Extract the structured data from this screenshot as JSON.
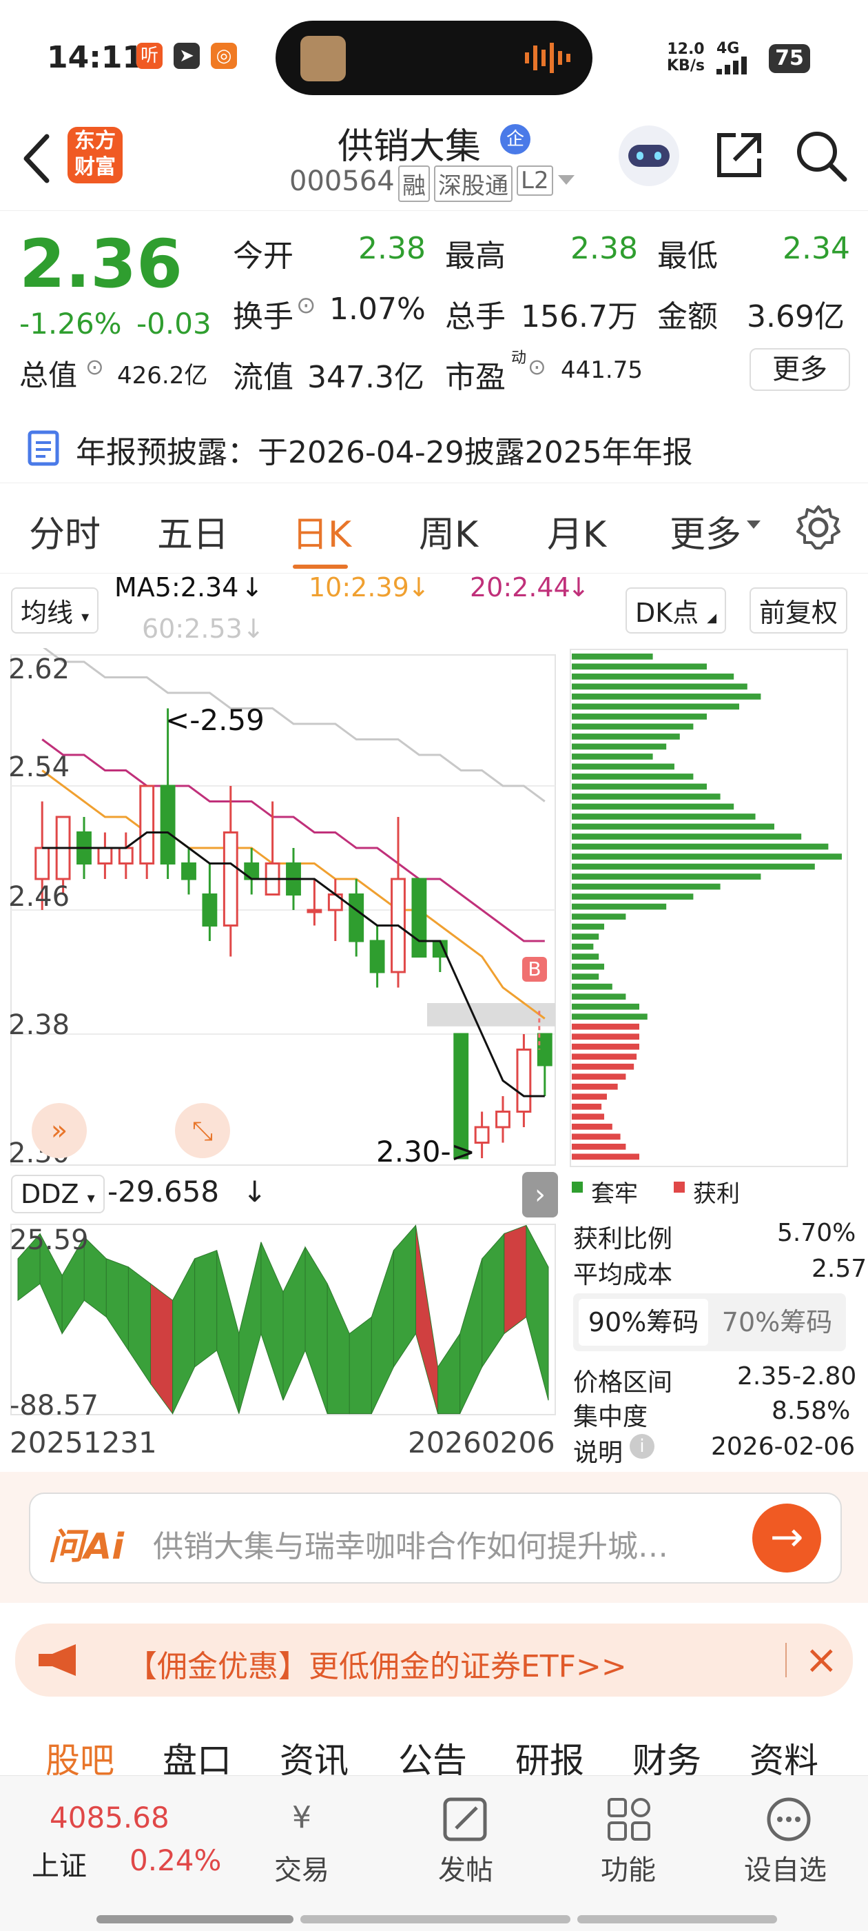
{
  "status": {
    "time": "14:11",
    "net_speed": "12.0",
    "net_unit": "KB/s",
    "net_type": "4G",
    "battery": "75"
  },
  "header": {
    "stock_name": "供销大集",
    "badge": "企",
    "code": "000564",
    "tags": [
      "融",
      "深股通",
      "L2"
    ]
  },
  "quote": {
    "price": "2.36",
    "change_pct": "-1.26%",
    "change": "-0.03",
    "open_label": "今开",
    "open": "2.38",
    "high_label": "最高",
    "high": "2.38",
    "low_label": "最低",
    "low": "2.34",
    "turnover_label": "换手",
    "turnover": "1.07%",
    "volume_label": "总手",
    "volume": "156.7万",
    "amount_label": "金额",
    "amount": "3.69亿",
    "mktcap_label": "总值",
    "mktcap": "426.2亿",
    "float_label": "流值",
    "float": "347.3亿",
    "pe_label": "市盈",
    "pe_sup": "动",
    "pe": "441.75",
    "more": "更多"
  },
  "banner": {
    "text": "年报预披露：于2026-04-29披露2025年年报"
  },
  "tabs": [
    {
      "label": "分时"
    },
    {
      "label": "五日"
    },
    {
      "label": "日K"
    },
    {
      "label": "周K"
    },
    {
      "label": "月K"
    },
    {
      "label": "更多"
    }
  ],
  "ma": {
    "selector": "均线",
    "ma5": "MA5:2.34",
    "ma10": "10:2.39",
    "ma20": "20:2.44",
    "ma60": "60:2.53",
    "dk": "DK点",
    "adjust": "前复权"
  },
  "kline": {
    "y_ticks": [
      "2.62",
      "2.54",
      "2.46",
      "2.38",
      "2.30"
    ],
    "annot_high": "<-2.59",
    "annot_low": "2.30->",
    "b_marker": "B",
    "colors": {
      "up": "#e04848",
      "down": "#2f9e2f",
      "ma5": "#111111",
      "ma10": "#f0a030",
      "ma20": "#c0307a",
      "ma60": "#c8c8c8"
    }
  },
  "chart_data": [
    {
      "type": "candlestick",
      "title": "日K",
      "ylim": [
        2.3,
        2.62
      ],
      "x_start": "20251231",
      "x_end": "20260206",
      "candles": [
        {
          "o": 2.48,
          "h": 2.53,
          "l": 2.46,
          "c": 2.5
        },
        {
          "o": 2.48,
          "h": 2.52,
          "l": 2.47,
          "c": 2.52
        },
        {
          "o": 2.51,
          "h": 2.52,
          "l": 2.48,
          "c": 2.49
        },
        {
          "o": 2.49,
          "h": 2.51,
          "l": 2.48,
          "c": 2.5
        },
        {
          "o": 2.49,
          "h": 2.51,
          "l": 2.48,
          "c": 2.5
        },
        {
          "o": 2.49,
          "h": 2.54,
          "l": 2.48,
          "c": 2.54
        },
        {
          "o": 2.54,
          "h": 2.59,
          "l": 2.48,
          "c": 2.49
        },
        {
          "o": 2.49,
          "h": 2.5,
          "l": 2.47,
          "c": 2.48
        },
        {
          "o": 2.47,
          "h": 2.49,
          "l": 2.44,
          "c": 2.45
        },
        {
          "o": 2.45,
          "h": 2.54,
          "l": 2.43,
          "c": 2.51
        },
        {
          "o": 2.49,
          "h": 2.5,
          "l": 2.47,
          "c": 2.48
        },
        {
          "o": 2.47,
          "h": 2.53,
          "l": 2.47,
          "c": 2.49
        },
        {
          "o": 2.49,
          "h": 2.5,
          "l": 2.46,
          "c": 2.47
        },
        {
          "o": 2.46,
          "h": 2.48,
          "l": 2.45,
          "c": 2.46
        },
        {
          "o": 2.46,
          "h": 2.48,
          "l": 2.44,
          "c": 2.47
        },
        {
          "o": 2.47,
          "h": 2.48,
          "l": 2.43,
          "c": 2.44
        },
        {
          "o": 2.44,
          "h": 2.45,
          "l": 2.41,
          "c": 2.42
        },
        {
          "o": 2.42,
          "h": 2.52,
          "l": 2.41,
          "c": 2.48
        },
        {
          "o": 2.48,
          "h": 2.48,
          "l": 2.43,
          "c": 2.43
        },
        {
          "o": 2.44,
          "h": 2.44,
          "l": 2.42,
          "c": 2.43
        },
        {
          "o": 2.38,
          "h": 2.38,
          "l": 2.3,
          "c": 2.3
        },
        {
          "o": 2.31,
          "h": 2.33,
          "l": 2.3,
          "c": 2.32
        },
        {
          "o": 2.32,
          "h": 2.34,
          "l": 2.31,
          "c": 2.33
        },
        {
          "o": 2.33,
          "h": 2.38,
          "l": 2.32,
          "c": 2.37
        },
        {
          "o": 2.38,
          "h": 2.38,
          "l": 2.34,
          "c": 2.36
        }
      ],
      "ma5": [
        2.5,
        2.5,
        2.5,
        2.5,
        2.5,
        2.51,
        2.51,
        2.5,
        2.49,
        2.49,
        2.48,
        2.48,
        2.48,
        2.48,
        2.47,
        2.46,
        2.45,
        2.45,
        2.44,
        2.44,
        2.41,
        2.38,
        2.35,
        2.34,
        2.34
      ],
      "ma10": [
        2.55,
        2.54,
        2.53,
        2.52,
        2.52,
        2.51,
        2.51,
        2.5,
        2.5,
        2.5,
        2.5,
        2.49,
        2.49,
        2.49,
        2.48,
        2.48,
        2.47,
        2.46,
        2.46,
        2.45,
        2.44,
        2.43,
        2.41,
        2.4,
        2.39
      ],
      "ma20": [
        2.57,
        2.56,
        2.56,
        2.55,
        2.55,
        2.54,
        2.54,
        2.54,
        2.53,
        2.53,
        2.53,
        2.52,
        2.52,
        2.51,
        2.51,
        2.5,
        2.5,
        2.49,
        2.48,
        2.48,
        2.47,
        2.46,
        2.45,
        2.44,
        2.44
      ],
      "ma60": [
        2.63,
        2.62,
        2.62,
        2.61,
        2.61,
        2.61,
        2.6,
        2.6,
        2.6,
        2.59,
        2.59,
        2.59,
        2.58,
        2.58,
        2.58,
        2.57,
        2.57,
        2.57,
        2.56,
        2.56,
        2.55,
        2.55,
        2.54,
        2.54,
        2.53
      ]
    },
    {
      "type": "area",
      "title": "DDZ",
      "value": "-29.658",
      "ylim": [
        -88.57,
        25.59
      ],
      "upper": [
        5,
        20,
        -5,
        18,
        5,
        0,
        -10,
        -20,
        5,
        10,
        -40,
        15,
        -15,
        12,
        -10,
        -40,
        -30,
        10,
        25,
        -60,
        -40,
        5,
        20,
        25,
        0
      ],
      "lower": [
        -20,
        -10,
        -40,
        -20,
        -30,
        -50,
        -70,
        -88,
        -60,
        -50,
        -88,
        -40,
        -80,
        -50,
        -88,
        -88,
        -88,
        -60,
        -40,
        -88,
        -88,
        -60,
        -40,
        -30,
        -80
      ]
    },
    {
      "type": "bar",
      "title": "筹码分布",
      "orientation": "horizontal",
      "profit": [
        0.25,
        0.25,
        0.25,
        0.24,
        0.23,
        0.2,
        0.17,
        0.13,
        0.11,
        0.12,
        0.15,
        0.18,
        0.2,
        0.25
      ],
      "loss": [
        0.3,
        0.5,
        0.6,
        0.65,
        0.7,
        0.62,
        0.5,
        0.45,
        0.4,
        0.35,
        0.3,
        0.38,
        0.45,
        0.5,
        0.55,
        0.6,
        0.68,
        0.75,
        0.85,
        0.95,
        1.0,
        0.9,
        0.7,
        0.55,
        0.45,
        0.35,
        0.2,
        0.12,
        0.1,
        0.08,
        0.1,
        0.12,
        0.1,
        0.15,
        0.2,
        0.25,
        0.28
      ]
    }
  ],
  "ddz": {
    "label": "DDZ",
    "value": "-29.658",
    "top": "25.59",
    "bottom": "-88.57",
    "date_start": "20251231",
    "date_end": "20260206"
  },
  "chips": {
    "legend_loss": "套牢",
    "legend_profit": "获利",
    "profit_ratio_label": "获利比例",
    "profit_ratio": "5.70%",
    "avg_cost_label": "平均成本",
    "avg_cost": "2.57",
    "tab_90": "90%筹码",
    "tab_70": "70%筹码",
    "range_label": "价格区间",
    "range": "2.35-2.80",
    "concentration_label": "集中度",
    "concentration": "8.58%",
    "note_label": "说明",
    "note_date": "2026-02-06"
  },
  "ai": {
    "logo": "问Ai",
    "text": "供销大集与瑞幸咖啡合作如何提升城…"
  },
  "promo": {
    "text": "【佣金优惠】更低佣金的证券ETF>>"
  },
  "navtabs": [
    "股吧",
    "盘口",
    "资讯",
    "公告",
    "研报",
    "财务",
    "资料"
  ],
  "bottom": {
    "index_value": "4085.68",
    "index_name": "上证",
    "index_change": "0.24%",
    "items": [
      {
        "label": "交易"
      },
      {
        "label": "发帖"
      },
      {
        "label": "功能"
      },
      {
        "label": "设自选"
      }
    ]
  }
}
